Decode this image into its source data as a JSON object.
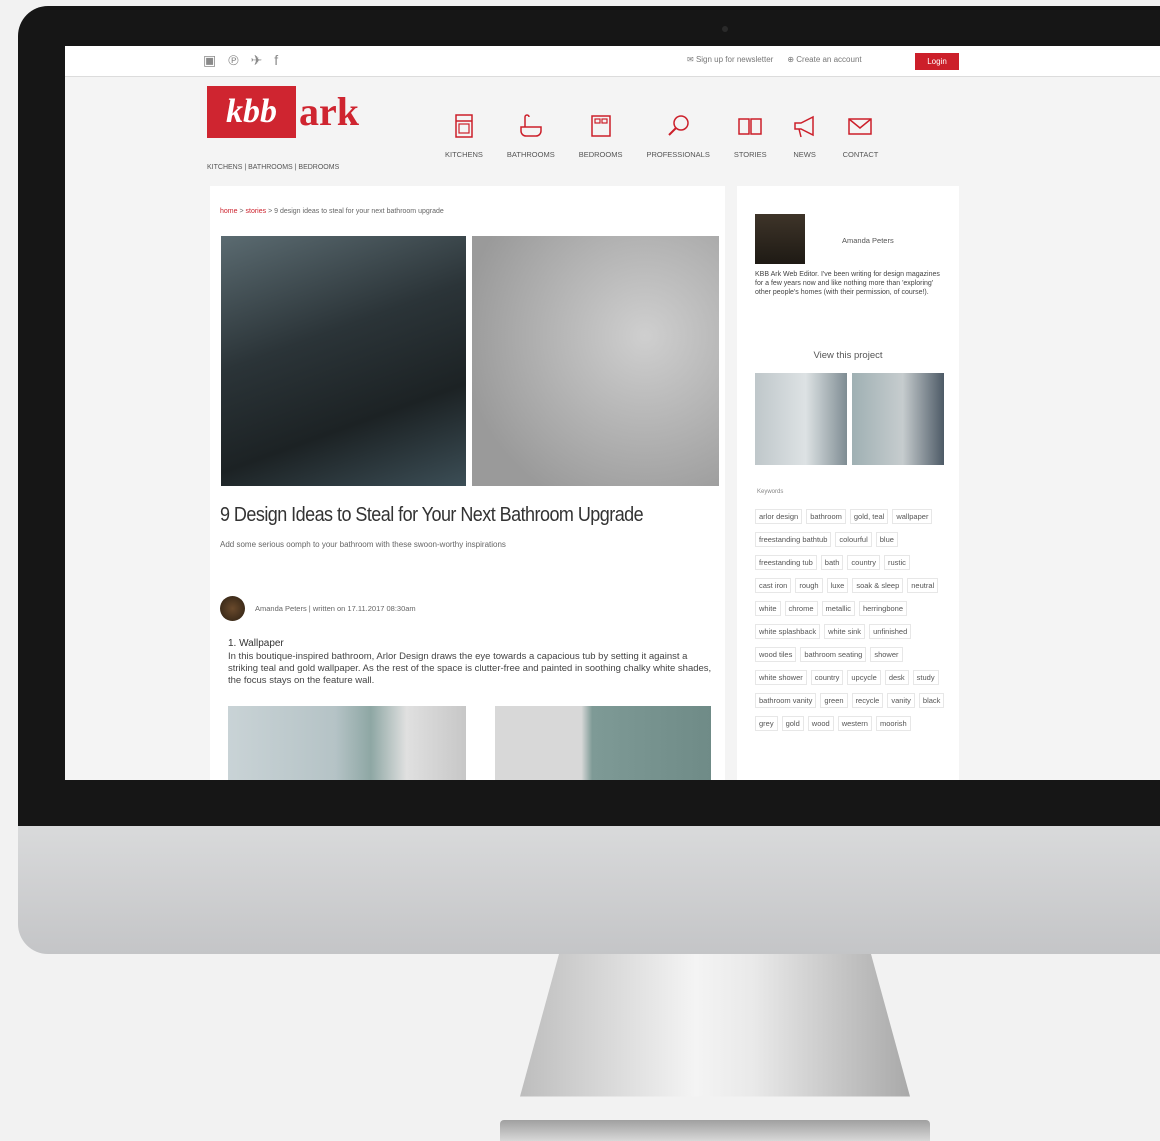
{
  "topbar": {
    "social_icons": [
      "instagram-icon",
      "pinterest-icon",
      "twitter-icon",
      "facebook-icon"
    ],
    "newsletter_label": "Sign up for newsletter",
    "create_account_label": "Create an account",
    "login_label": "Login"
  },
  "logo": {
    "part1": "kbb",
    "part2": "ark",
    "tagline": "KITCHENS | BATHROOMS | BEDROOMS"
  },
  "nav": {
    "items": [
      {
        "label": "KITCHENS",
        "icon": "oven-icon"
      },
      {
        "label": "BATHROOMS",
        "icon": "bathtub-icon"
      },
      {
        "label": "BEDROOMS",
        "icon": "bed-icon"
      },
      {
        "label": "PROFESSIONALS",
        "icon": "magnifier-icon"
      },
      {
        "label": "STORIES",
        "icon": "book-icon"
      },
      {
        "label": "NEWS",
        "icon": "megaphone-icon"
      },
      {
        "label": "CONTACT",
        "icon": "envelope-icon"
      }
    ]
  },
  "article": {
    "breadcrumb_home": "home",
    "breadcrumb_stories": "stories",
    "breadcrumb_current": "9 design ideas to steal for your next bathroom upgrade",
    "title": "9 Design Ideas to Steal for Your Next Bathroom Upgrade",
    "subtitle": "Add some serious oomph to your bathroom with these swoon-worthy inspirations",
    "author": "Amanda Peters",
    "written": "written on 17.11.2017 08:30am",
    "section1_title": "1. Wallpaper",
    "section1_body": "In this boutique-inspired bathroom, Arlor Design draws the eye towards a capacious tub by setting it against a striking teal and gold wallpaper. As the rest of the space is clutter-free and painted in soothing chalky white shades, the focus stays on the feature wall."
  },
  "sidebar": {
    "author_name": "Amanda Peters",
    "bio": "KBB Ark Web Editor. I've been writing for design magazines for a few years now and like nothing more than 'exploring' other people's homes (with their permission, of course!).",
    "view_project": "View this project",
    "keywords_label": "Keywords",
    "tags": [
      "arlor design",
      "bathroom",
      "gold, teal",
      "wallpaper",
      "freestanding bathtub",
      "colourful",
      "blue",
      "freestanding tub",
      "bath",
      "country",
      "rustic",
      "cast iron",
      "rough",
      "luxe",
      "soak & sleep",
      "neutral",
      "white",
      "chrome",
      "metallic",
      "herringbone",
      "white splashback",
      "white sink",
      "unfinished",
      "wood tiles",
      "bathroom seating",
      "shower",
      "white shower",
      "country",
      "upcycle",
      "desk",
      "study",
      "bathroom vanity",
      "green",
      "recycle",
      "vanity",
      "black",
      "grey",
      "gold",
      "wood",
      "western",
      "moorish"
    ]
  },
  "colors": {
    "brand_red": "#cc1f2a"
  }
}
